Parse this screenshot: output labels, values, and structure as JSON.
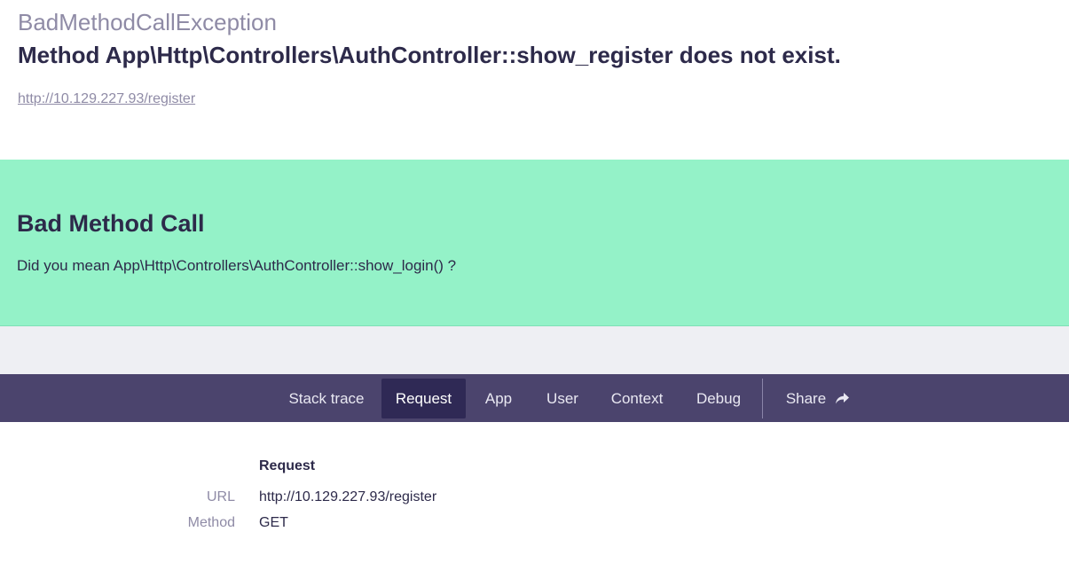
{
  "header": {
    "exception_class": "BadMethodCallException",
    "exception_message": "Method App\\Http\\Controllers\\AuthController::show_register does not exist.",
    "url": "http://10.129.227.93/register"
  },
  "solution": {
    "title": "Bad Method Call",
    "text": "Did you mean App\\Http\\Controllers\\AuthController::show_login() ?"
  },
  "tabs": [
    {
      "label": "Stack trace",
      "active": false
    },
    {
      "label": "Request",
      "active": true
    },
    {
      "label": "App",
      "active": false
    },
    {
      "label": "User",
      "active": false
    },
    {
      "label": "Context",
      "active": false
    },
    {
      "label": "Debug",
      "active": false
    }
  ],
  "share": {
    "label": "Share",
    "icon": "share-arrow-icon"
  },
  "request": {
    "title": "Request",
    "rows": [
      {
        "label": "URL",
        "value": "http://10.129.227.93/register"
      },
      {
        "label": "Method",
        "value": "GET"
      }
    ]
  },
  "colors": {
    "solution_bg": "#94f2c8",
    "tabbar_bg": "#4b446d",
    "active_tab_bg": "#2f2955",
    "muted_text": "#8f8ba6",
    "main_text": "#2d2a4a"
  }
}
